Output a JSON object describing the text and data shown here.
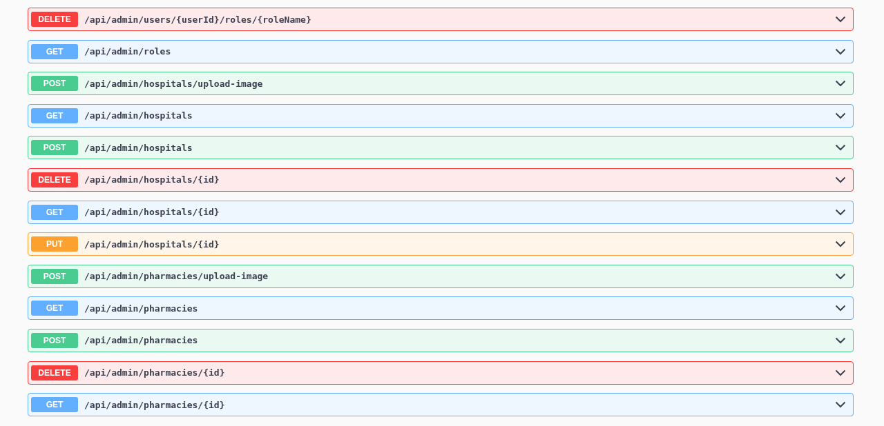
{
  "operations": [
    {
      "method": "DELETE",
      "path": "/api/admin/users/{userId}/roles/{roleName}",
      "color": "#f93e3e"
    },
    {
      "method": "GET",
      "path": "/api/admin/roles",
      "color": "#61affe"
    },
    {
      "method": "POST",
      "path": "/api/admin/hospitals/upload-image",
      "color": "#49cc90"
    },
    {
      "method": "GET",
      "path": "/api/admin/hospitals",
      "color": "#61affe"
    },
    {
      "method": "POST",
      "path": "/api/admin/hospitals",
      "color": "#49cc90"
    },
    {
      "method": "DELETE",
      "path": "/api/admin/hospitals/{id}",
      "color": "#f93e3e"
    },
    {
      "method": "GET",
      "path": "/api/admin/hospitals/{id}",
      "color": "#61affe"
    },
    {
      "method": "PUT",
      "path": "/api/admin/hospitals/{id}",
      "color": "#fca130"
    },
    {
      "method": "POST",
      "path": "/api/admin/pharmacies/upload-image",
      "color": "#49cc90"
    },
    {
      "method": "GET",
      "path": "/api/admin/pharmacies",
      "color": "#61affe"
    },
    {
      "method": "POST",
      "path": "/api/admin/pharmacies",
      "color": "#49cc90"
    },
    {
      "method": "DELETE",
      "path": "/api/admin/pharmacies/{id}",
      "color": "#f93e3e"
    },
    {
      "method": "GET",
      "path": "/api/admin/pharmacies/{id}",
      "color": "#61affe"
    }
  ]
}
